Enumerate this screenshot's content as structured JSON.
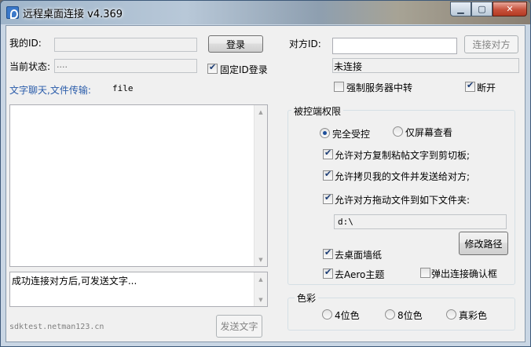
{
  "window": {
    "title": "远程桌面连接 v4.369",
    "controls": {
      "minimize": "▁",
      "maximize": "▢",
      "close": "✕"
    }
  },
  "left": {
    "my_id_label": "我的ID:",
    "my_id_value": "",
    "login_button": "登录",
    "status_label": "当前状态:",
    "status_value": "....",
    "fixed_id_label": "固定ID登录",
    "fixed_id_checked": true,
    "chat_label": "文字聊天,文件传输:",
    "file_label": "file",
    "chat_log": "",
    "message_placeholder": "成功连接对方后,可发送文字...",
    "footer_url": "sdktest.netman123.cn",
    "send_button": "发送文字"
  },
  "right": {
    "peer_id_label": "对方ID:",
    "peer_id_value": "",
    "connect_button": "连接对方",
    "connection_status": "未连接",
    "force_relay_label": "强制服务器中转",
    "force_relay_checked": false,
    "disconnect_label": "断开",
    "disconnect_checked": true
  },
  "permissions": {
    "title": "被控端权限",
    "full_control_label": "完全受控",
    "view_only_label": "仅屏幕查看",
    "selected_mode": "full_control",
    "allow_clipboard_label": "允许对方复制粘帖文字到剪切板;",
    "allow_clipboard_checked": true,
    "allow_copy_files_label": "允许拷贝我的文件并发送给对方;",
    "allow_copy_files_checked": true,
    "allow_drag_files_label": "允许对方拖动文件到如下文件夹:",
    "allow_drag_files_checked": true,
    "folder_path": "d:\\",
    "change_path_button": "修改路径",
    "remove_wallpaper_label": "去桌面墙纸",
    "remove_wallpaper_checked": true,
    "remove_aero_label": "去Aero主题",
    "remove_aero_checked": true,
    "confirm_dialog_label": "弹出连接确认框",
    "confirm_dialog_checked": false
  },
  "color": {
    "title": "色彩",
    "options": [
      "4位色",
      "8位色",
      "真彩色"
    ],
    "selected": null
  },
  "icons": {
    "up": "▲",
    "down": "▼"
  }
}
